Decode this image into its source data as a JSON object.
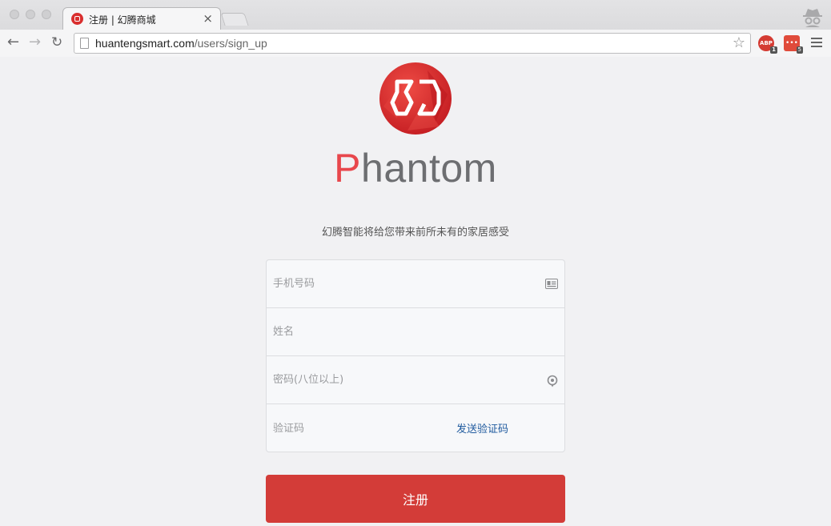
{
  "browser": {
    "tab_title": "注册 | 幻腾商城",
    "tab_close": "×",
    "url_host": "huantengsmart.com",
    "url_path": "/users/sign_up",
    "ext_abp_label": "ABP",
    "ext_abp_badge": "1",
    "ext_dots_label": "•••",
    "ext_dots_badge": "5"
  },
  "brand": {
    "first_letter": "P",
    "rest": "hantom",
    "logo_color": "#d92e2e",
    "accent_color": "#e8474c"
  },
  "tagline": "幻腾智能将给您带来前所未有的家居感受",
  "form": {
    "phone_placeholder": "手机号码",
    "name_placeholder": "姓名",
    "password_placeholder": "密码(八位以上)",
    "code_placeholder": "验证码",
    "send_code": "发送验证码"
  },
  "submit": {
    "label": "注册",
    "color": "#d33c38"
  }
}
